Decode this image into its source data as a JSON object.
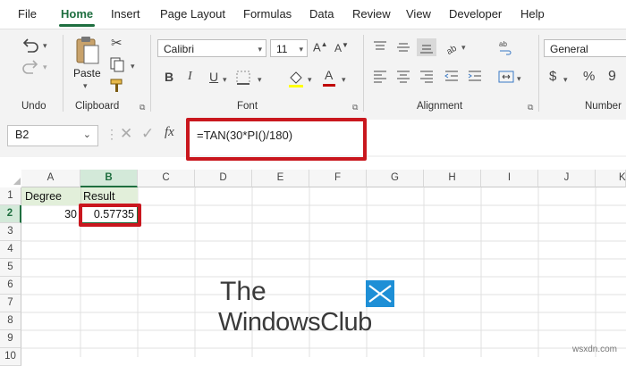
{
  "menu": {
    "tabs": [
      "File",
      "Home",
      "Insert",
      "Page Layout",
      "Formulas",
      "Data",
      "Review",
      "View",
      "Developer",
      "Help"
    ],
    "active": "Home"
  },
  "ribbon": {
    "groups": {
      "undo": "Undo",
      "clipboard": "Clipboard",
      "font": "Font",
      "alignment": "Alignment",
      "number": "Number"
    },
    "paste_label": "Paste",
    "font_name": "Calibri",
    "font_size": "11",
    "number_format": "General",
    "font_color": "#c00000",
    "highlight_color": "#ffff00"
  },
  "formula_bar": {
    "name_box": "B2",
    "fx_label": "fx",
    "formula": "=TAN(30*PI()/180)"
  },
  "grid": {
    "columns": [
      "A",
      "B",
      "C",
      "D",
      "E",
      "F",
      "G",
      "H",
      "I",
      "J",
      "K"
    ],
    "selected_column": "B",
    "rows": [
      "1",
      "2",
      "3",
      "4",
      "5",
      "6",
      "7",
      "8",
      "9",
      "10"
    ],
    "selected_row": "2",
    "cells": {
      "A1": "Degree",
      "B1": "Result",
      "A2": "30",
      "B2": "0.57735"
    }
  },
  "watermark": {
    "line1": "The",
    "line2": "WindowsClub",
    "site": "wsxdn.com"
  },
  "colors": {
    "accent": "#1e6e3f",
    "highlight_red": "#c9171e",
    "header_fill": "#e2efda"
  }
}
